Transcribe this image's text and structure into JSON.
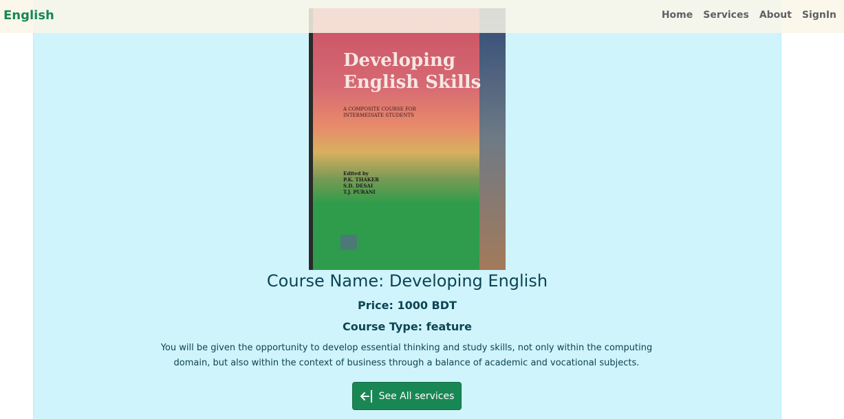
{
  "brand": "English",
  "nav": {
    "items": [
      "Home",
      "Services",
      "About",
      "SignIn"
    ]
  },
  "book": {
    "title_line1": "Developing",
    "title_line2": "English Skills",
    "subtitle": "A COMPOSITE COURSE FOR INTERMEDIATE STUDENTS",
    "editors": [
      "Edited by",
      "P.K. THAKER",
      "S.D. DESAI",
      "T.J. PURANI"
    ]
  },
  "course": {
    "name": "Course Name: Developing English",
    "price": "Price: 1000 BDT",
    "type": "Course Type: feature",
    "description": "You will be given the opportunity to develop essential thinking and study skills, not only within the computing domain, but also within the context of business through a balance of academic and vocational subjects."
  },
  "button": {
    "label": "See All services",
    "icon": "arrow-left-bar-icon"
  },
  "colors": {
    "accent": "#198754",
    "card_bg": "#cff4fc",
    "text": "#0c4453"
  }
}
